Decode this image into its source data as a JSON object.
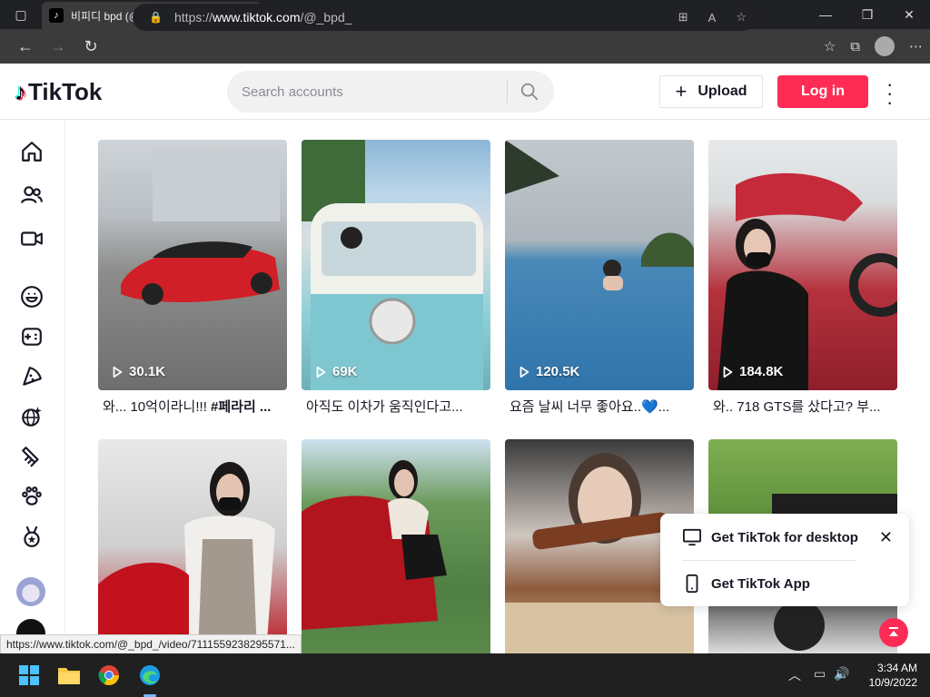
{
  "browser": {
    "tab_title": "비피디 bpd (@_bpd_) TikTok | Wa",
    "url_prefix": "https://",
    "url_host": "www.tiktok.com",
    "url_path": "/@_bpd_",
    "status_url": "https://www.tiktok.com/@_bpd_/video/7111559238295571..."
  },
  "header": {
    "logo_text": "TikTok",
    "search_placeholder": "Search accounts",
    "upload_label": "Upload",
    "login_label": "Log in"
  },
  "videos": [
    {
      "views": "30.1K",
      "caption_plain": "와... 10억이라니!!! ",
      "caption_bold": "#페라리 ..."
    },
    {
      "views": "69K",
      "caption_plain": "아직도 이차가 움직인다고...",
      "caption_bold": ""
    },
    {
      "views": "120.5K",
      "caption_plain": "요즘 날씨 너무 좋아요..💙...",
      "caption_bold": ""
    },
    {
      "views": "184.8K",
      "caption_plain": "와.. 718 GTS를 샀다고? 부...",
      "caption_bold": ""
    }
  ],
  "popup": {
    "desktop_label": "Get TikTok for desktop",
    "app_label": "Get TikTok App"
  },
  "taskbar": {
    "time": "3:34 AM",
    "date": "10/9/2022"
  },
  "colors": {
    "brand_red": "#fe2c55",
    "text_dark": "#161823"
  }
}
